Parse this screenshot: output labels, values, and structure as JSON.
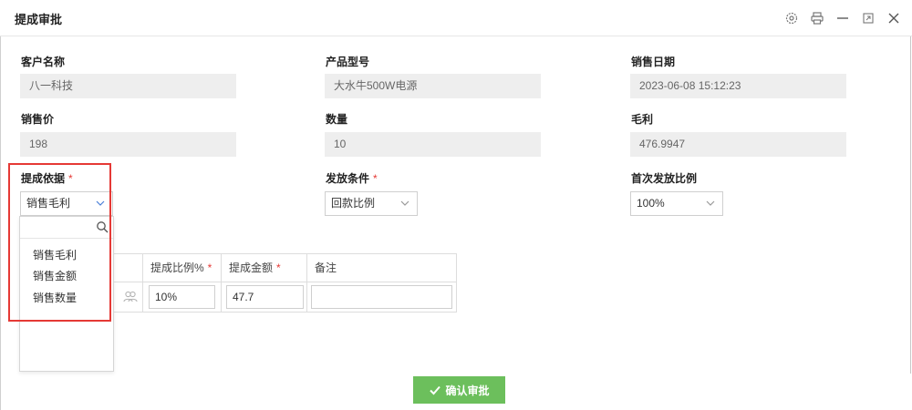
{
  "window": {
    "title": "提成审批",
    "icons": [
      "gear-icon",
      "printer-icon",
      "minimize-icon",
      "restore-icon",
      "close-icon"
    ]
  },
  "fields": {
    "customer": {
      "label": "客户名称",
      "value": "八一科技"
    },
    "product": {
      "label": "产品型号",
      "value": "大水牛500W电源"
    },
    "sale_date": {
      "label": "销售日期",
      "value": "2023-06-08 15:12:23"
    },
    "price": {
      "label": "销售价",
      "value": "198"
    },
    "quantity": {
      "label": "数量",
      "value": "10"
    },
    "gross_profit": {
      "label": "毛利",
      "value": "476.9947"
    },
    "commission_basis": {
      "label": "提成依据",
      "required_mark": "*",
      "value": "销售毛利"
    },
    "payout_condition": {
      "label": "发放条件",
      "required_mark": "*",
      "value": "回款比例"
    },
    "first_payout_ratio": {
      "label": "首次发放比例",
      "value": "100%"
    }
  },
  "dropdown": {
    "search_placeholder": "",
    "options": [
      "销售毛利",
      "销售金额",
      "销售数量"
    ]
  },
  "table": {
    "headers": {
      "ratio": "提成比例%",
      "amount": "提成金额",
      "note": "备注",
      "required_mark": "*"
    },
    "row": {
      "ratio": "10%",
      "amount": "47.7",
      "note": ""
    }
  },
  "actions": {
    "confirm_label": "确认审批"
  },
  "colors": {
    "required": "#e53935",
    "confirm_bg": "#6cbf5c",
    "highlight": "#e53935",
    "caret_active": "#4a7fd8"
  }
}
